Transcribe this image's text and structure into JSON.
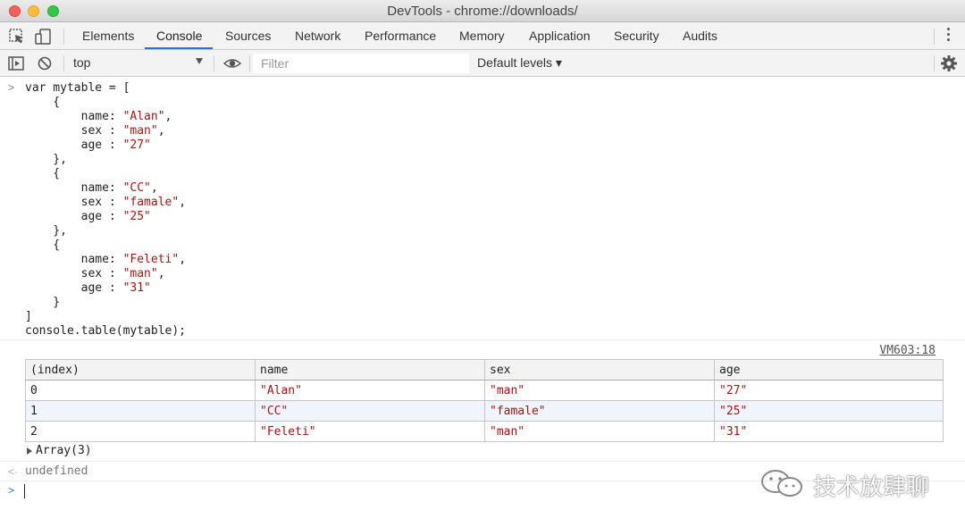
{
  "window": {
    "title": "DevTools - chrome://downloads/"
  },
  "tabs": [
    {
      "label": "Elements"
    },
    {
      "label": "Console"
    },
    {
      "label": "Sources"
    },
    {
      "label": "Network"
    },
    {
      "label": "Performance"
    },
    {
      "label": "Memory"
    },
    {
      "label": "Application"
    },
    {
      "label": "Security"
    },
    {
      "label": "Audits"
    }
  ],
  "active_tab": "Console",
  "toolbar": {
    "context": "top",
    "filter_placeholder": "Filter",
    "levels": "Default levels ▾"
  },
  "code": [
    [
      "var mytable = ["
    ],
    [
      "    {"
    ],
    [
      "        name: ",
      "\"Alan\"",
      ","
    ],
    [
      "        sex : ",
      "\"man\"",
      ","
    ],
    [
      "        age : ",
      "\"27\""
    ],
    [
      "    },"
    ],
    [
      "    {"
    ],
    [
      "        name: ",
      "\"CC\"",
      ","
    ],
    [
      "        sex : ",
      "\"famale\"",
      ","
    ],
    [
      "        age : ",
      "\"25\""
    ],
    [
      "    },"
    ],
    [
      "    {"
    ],
    [
      "        name: ",
      "\"Feleti\"",
      ","
    ],
    [
      "        sex : ",
      "\"man\"",
      ","
    ],
    [
      "        age : ",
      "\"31\""
    ],
    [
      "    }"
    ],
    [
      "]"
    ],
    [
      "console.table(mytable);"
    ]
  ],
  "source_link": "VM603:18",
  "table": {
    "headers": [
      "(index)",
      "name",
      "sex",
      "age"
    ],
    "rows": [
      [
        "0",
        "\"Alan\"",
        "\"man\"",
        "\"27\""
      ],
      [
        "1",
        "\"CC\"",
        "\"famale\"",
        "\"25\""
      ],
      [
        "2",
        "\"Feleti\"",
        "\"man\"",
        "\"31\""
      ]
    ]
  },
  "array_summary": "Array(3)",
  "return_value": "undefined",
  "watermark": "技术放肆聊",
  "colors": {
    "accent": "#1a73e8",
    "string": "#a31515"
  }
}
